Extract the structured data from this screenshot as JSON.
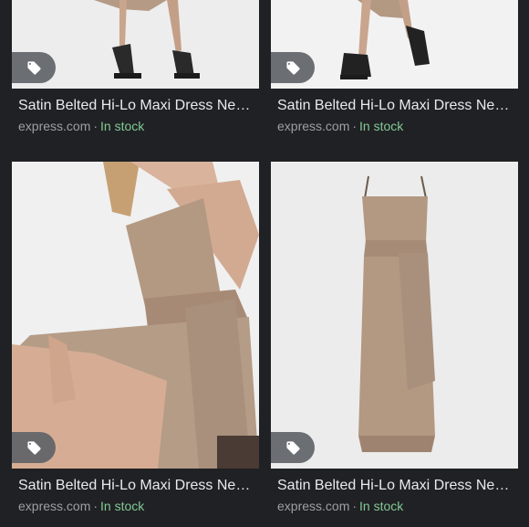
{
  "colors": {
    "background": "#202124",
    "title": "#e8eaed",
    "source": "#9aa0a6",
    "stock": "#81c995",
    "dress": "#b39882"
  },
  "results": [
    {
      "title": "Satin Belted Hi-Lo Maxi Dress Ne…",
      "source": "express.com",
      "separator": "·",
      "stock": "In stock",
      "icon": "tag-icon"
    },
    {
      "title": "Satin Belted Hi-Lo Maxi Dress Ne…",
      "source": "express.com",
      "separator": "·",
      "stock": "In stock",
      "icon": "tag-icon"
    },
    {
      "title": "Satin Belted Hi-Lo Maxi Dress Ne…",
      "source": "express.com",
      "separator": "·",
      "stock": "In stock",
      "icon": "tag-icon"
    },
    {
      "title": "Satin Belted Hi-Lo Maxi Dress Ne…",
      "source": "express.com",
      "separator": "·",
      "stock": "In stock",
      "icon": "tag-icon"
    }
  ]
}
